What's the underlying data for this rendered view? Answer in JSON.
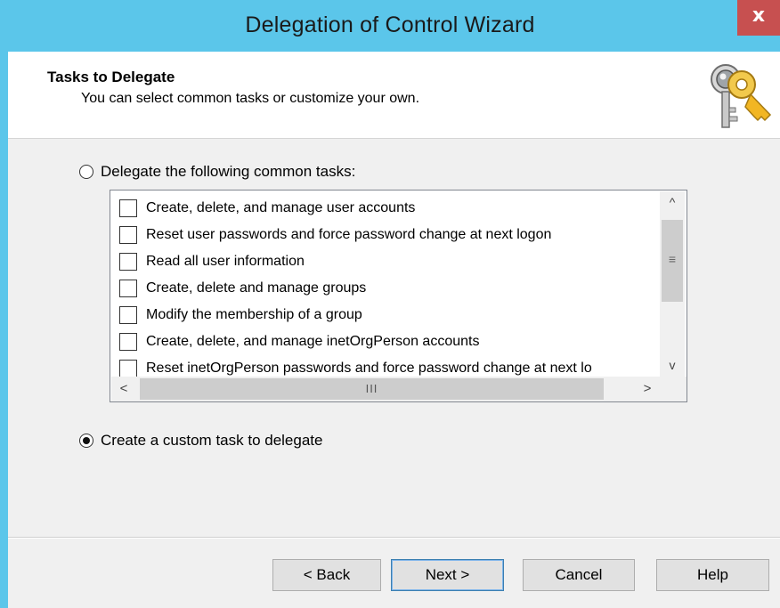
{
  "window": {
    "title": "Delegation of Control Wizard",
    "close_glyph": "x"
  },
  "header": {
    "title": "Tasks to Delegate",
    "subtitle": "You can select common tasks or customize your own.",
    "icon": "keys-icon"
  },
  "options": {
    "common_tasks_label": "Delegate the following common tasks:",
    "common_tasks_selected": false,
    "custom_task_label": "Create a custom task to delegate",
    "custom_task_selected": true
  },
  "tasks": [
    {
      "label": "Create, delete, and manage user accounts",
      "checked": false
    },
    {
      "label": "Reset user passwords and force password change at next logon",
      "checked": false
    },
    {
      "label": "Read all user information",
      "checked": false
    },
    {
      "label": "Create, delete and manage groups",
      "checked": false
    },
    {
      "label": "Modify the membership of a group",
      "checked": false
    },
    {
      "label": "Create, delete, and manage inetOrgPerson accounts",
      "checked": false
    },
    {
      "label": "Reset inetOrgPerson passwords and force password change at next lo",
      "checked": false
    }
  ],
  "scrollbars": {
    "up_glyph": "^",
    "down_glyph": "v",
    "left_glyph": "<",
    "right_glyph": ">",
    "v_grip": "≡",
    "h_grip": "III"
  },
  "buttons": {
    "back": "< Back",
    "next": "Next >",
    "cancel": "Cancel",
    "help": "Help"
  },
  "colors": {
    "title_bar": "#5bc6ea",
    "close_button": "#c75050",
    "dialog_bg": "#f0f0f0"
  }
}
